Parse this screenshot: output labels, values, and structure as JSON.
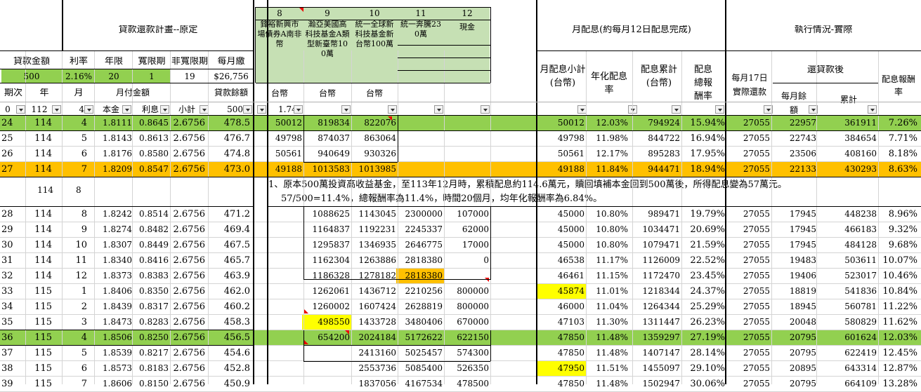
{
  "plan_title": "貸款還款計畫--原定",
  "dividend_title": "月配息(約每月12日配息完成)",
  "exec_title": "執行情況-實際",
  "loan_headers": [
    "貸款金額",
    "利率",
    "年限",
    "寬限期",
    "非寬限期",
    "每月繳"
  ],
  "loan_values": [
    "500",
    "2.16%",
    "20",
    "1",
    "19",
    "$26,756"
  ],
  "col_headers": [
    "期次",
    "年",
    "月",
    "月付金額",
    "貸款餘額"
  ],
  "filter_row": [
    "0",
    "112",
    "4",
    "本金",
    "利息",
    "小計",
    "500",
    "1.74"
  ],
  "funds": [
    {
      "no": "8",
      "name": "鋒裕新興市場債券A南非幣"
    },
    {
      "no": "9",
      "name": "瀚亞美國高科技基金A類型新臺幣100萬"
    },
    {
      "no": "10",
      "name": "統一全球新科技基金新台幣100萬"
    },
    {
      "no": "11",
      "name": "統一奔騰230萬"
    },
    {
      "no": "12",
      "name": "現金"
    }
  ],
  "currency_labels": [
    "台幣",
    "台幣",
    "台幣"
  ],
  "div_headers": [
    "月配息小計(台幣)",
    "年化配息率",
    "配息累計(台幣)",
    "配息總報酬率"
  ],
  "exec_headers": {
    "repay": "每月17日實際還款",
    "after": "還貸款後",
    "monthly": "每月餘額",
    "cumulative": "累計",
    "rate": "配息報酬率"
  },
  "note_line1": "1、原本500萬投資高收益基金，至113年12月時，累積配息約114.6萬元，贖回填補本金回到500萬後，所得配息變為57萬元。",
  "note_line2": "57/500=11.4%，總報酬率為11.4%，時間20個月，均年化報酬率為6.84%。",
  "rows": [
    {
      "p": "24",
      "y": "114",
      "m": "4",
      "pr": "1.8111",
      "it": "0.8645",
      "st": "2.6756",
      "bal": "478.5",
      "f8": "50012",
      "f9": "819834",
      "f10": "822076",
      "f11": "",
      "f12": "",
      "ds": "50012",
      "ar": "12.03%",
      "cum": "794924",
      "tr": "15.94%",
      "rp": "27055",
      "mb": "22957",
      "cb": "361911",
      "rr": "7.26%",
      "hl": "green"
    },
    {
      "p": "25",
      "y": "114",
      "m": "5",
      "pr": "1.8143",
      "it": "0.8613",
      "st": "2.6756",
      "bal": "476.7",
      "f8": "49798",
      "f9": "874037",
      "f10": "863064",
      "f11": "",
      "f12": "",
      "ds": "49798",
      "ar": "11.98%",
      "cum": "844722",
      "tr": "16.94%",
      "rp": "27055",
      "mb": "22743",
      "cb": "384654",
      "rr": "7.71%",
      "hl": ""
    },
    {
      "p": "26",
      "y": "114",
      "m": "6",
      "pr": "1.8176",
      "it": "0.8580",
      "st": "2.6756",
      "bal": "474.8",
      "f8": "50561",
      "f9": "940649",
      "f10": "930326",
      "f11": "",
      "f12": "",
      "ds": "50561",
      "ar": "12.17%",
      "cum": "895283",
      "tr": "17.95%",
      "rp": "27055",
      "mb": "23506",
      "cb": "408160",
      "rr": "8.18%",
      "hl": ""
    },
    {
      "p": "27",
      "y": "114",
      "m": "7",
      "pr": "1.8209",
      "it": "0.8547",
      "st": "2.6756",
      "bal": "473.0",
      "f8": "49188",
      "f9": "1013583",
      "f10": "1013985",
      "f11": "",
      "f12": "",
      "ds": "49188",
      "ar": "11.84%",
      "cum": "944471",
      "tr": "18.94%",
      "rp": "27055",
      "mb": "22133",
      "cb": "430293",
      "rr": "8.63%",
      "hl": "orange"
    },
    {
      "p": "",
      "y": "114",
      "m": "8",
      "pr": "",
      "it": "",
      "st": "",
      "bal": "",
      "f8": "",
      "f9": "",
      "f10": "",
      "f11": "",
      "f12": "",
      "ds": "",
      "ar": "",
      "cum": "",
      "tr": "",
      "rp": "",
      "mb": "",
      "cb": "",
      "rr": "",
      "hl": "note"
    },
    {
      "p": "28",
      "y": "114",
      "m": "8",
      "pr": "1.8242",
      "it": "0.8514",
      "st": "2.6756",
      "bal": "471.2",
      "f8": "",
      "f9": "1088625",
      "f10": "1143045",
      "f11": "2300000",
      "f12": "107000",
      "ds": "45000",
      "ar": "10.80%",
      "cum": "989471",
      "tr": "19.79%",
      "rp": "27055",
      "mb": "17945",
      "cb": "448238",
      "rr": "8.96%",
      "hl": ""
    },
    {
      "p": "29",
      "y": "114",
      "m": "9",
      "pr": "1.8274",
      "it": "0.8482",
      "st": "2.6756",
      "bal": "469.4",
      "f8": "",
      "f9": "1164837",
      "f10": "1192231",
      "f11": "2245337",
      "f12": "62000",
      "ds": "45000",
      "ar": "10.80%",
      "cum": "1034471",
      "tr": "20.69%",
      "rp": "27055",
      "mb": "17945",
      "cb": "466183",
      "rr": "9.32%",
      "hl": ""
    },
    {
      "p": "30",
      "y": "114",
      "m": "10",
      "pr": "1.8307",
      "it": "0.8449",
      "st": "2.6756",
      "bal": "467.5",
      "f8": "",
      "f9": "1295837",
      "f10": "1346935",
      "f11": "2646775",
      "f12": "17000",
      "ds": "45000",
      "ar": "10.80%",
      "cum": "1079471",
      "tr": "21.59%",
      "rp": "27055",
      "mb": "17945",
      "cb": "484128",
      "rr": "9.68%",
      "hl": ""
    },
    {
      "p": "31",
      "y": "114",
      "m": "11",
      "pr": "1.8340",
      "it": "0.8416",
      "st": "2.6756",
      "bal": "465.7",
      "f8": "",
      "f9": "1162304",
      "f10": "1263886",
      "f11": "2818380",
      "f12": "0",
      "ds": "46538",
      "ar": "11.17%",
      "cum": "1126009",
      "tr": "22.52%",
      "rp": "27055",
      "mb": "19483",
      "cb": "503611",
      "rr": "10.07%",
      "hl": ""
    },
    {
      "p": "32",
      "y": "114",
      "m": "12",
      "pr": "1.8373",
      "it": "0.8383",
      "st": "2.6756",
      "bal": "463.9",
      "f8": "",
      "f9": "1186328",
      "f10": "1278182",
      "f11": "2818380",
      "f12": "",
      "ds": "46461",
      "ar": "11.15%",
      "cum": "1172470",
      "tr": "23.45%",
      "rp": "27055",
      "mb": "19406",
      "cb": "523017",
      "rr": "10.46%",
      "hl": ""
    },
    {
      "p": "33",
      "y": "115",
      "m": "1",
      "pr": "1.8406",
      "it": "0.8350",
      "st": "2.6756",
      "bal": "462.0",
      "f8": "",
      "f9": "1262061",
      "f10": "1436712",
      "f11": "2210256",
      "f12": "800000",
      "ds": "45874",
      "ar": "11.01%",
      "cum": "1218344",
      "tr": "24.37%",
      "rp": "27055",
      "mb": "18819",
      "cb": "541836",
      "rr": "10.84%",
      "hl": ""
    },
    {
      "p": "34",
      "y": "115",
      "m": "2",
      "pr": "1.8439",
      "it": "0.8317",
      "st": "2.6756",
      "bal": "460.2",
      "f8": "",
      "f9": "1260002",
      "f10": "1607424",
      "f11": "2628819",
      "f12": "800000",
      "ds": "46000",
      "ar": "11.04%",
      "cum": "1264344",
      "tr": "25.29%",
      "rp": "27055",
      "mb": "18945",
      "cb": "560781",
      "rr": "11.22%",
      "hl": ""
    },
    {
      "p": "35",
      "y": "115",
      "m": "3",
      "pr": "1.8473",
      "it": "0.8283",
      "st": "2.6756",
      "bal": "458.3",
      "f8": "",
      "f9": "498550",
      "f10": "1433728",
      "f11": "3480406",
      "f12": "670000",
      "ds": "47103",
      "ar": "11.30%",
      "cum": "1311447",
      "tr": "26.23%",
      "rp": "27055",
      "mb": "20048",
      "cb": "580829",
      "rr": "11.62%",
      "hl": ""
    },
    {
      "p": "36",
      "y": "115",
      "m": "4",
      "pr": "1.8506",
      "it": "0.8250",
      "st": "2.6756",
      "bal": "456.5",
      "f8": "",
      "f9": "654200",
      "f10": "2024184",
      "f11": "5172622",
      "f12": "622150",
      "ds": "47850",
      "ar": "11.48%",
      "cum": "1359297",
      "tr": "27.19%",
      "rp": "27055",
      "mb": "20795",
      "cb": "601624",
      "rr": "12.03%",
      "hl": "green"
    },
    {
      "p": "37",
      "y": "115",
      "m": "5",
      "pr": "1.8539",
      "it": "0.8217",
      "st": "2.6756",
      "bal": "454.6",
      "f8": "",
      "f9": "",
      "f10": "2413160",
      "f11": "5025457",
      "f12": "574300",
      "ds": "47850",
      "ar": "11.48%",
      "cum": "1407147",
      "tr": "28.14%",
      "rp": "27055",
      "mb": "20795",
      "cb": "622419",
      "rr": "12.45%",
      "hl": ""
    },
    {
      "p": "38",
      "y": "115",
      "m": "6",
      "pr": "1.8573",
      "it": "0.8183",
      "st": "2.6756",
      "bal": "452.8",
      "f8": "",
      "f9": "",
      "f10": "2553736",
      "f11": "5085400",
      "f12": "526350",
      "ds": "47950",
      "ar": "11.51%",
      "cum": "1455097",
      "tr": "29.10%",
      "rp": "27055",
      "mb": "20895",
      "cb": "643314",
      "rr": "12.87%",
      "hl": ""
    },
    {
      "p": "39",
      "y": "115",
      "m": "7",
      "pr": "1.8606",
      "it": "0.8150",
      "st": "2.6756",
      "bal": "450.9",
      "f8": "",
      "f9": "",
      "f10": "1837056",
      "f11": "4167534",
      "f12": "478500",
      "ds": "47850",
      "ar": "11.48%",
      "cum": "1502947",
      "tr": "30.06%",
      "rp": "27055",
      "mb": "20795",
      "cb": "664109",
      "rr": "13.28%",
      "hl": ""
    }
  ],
  "colors": {
    "green": "#92d050",
    "orange": "#ffc000",
    "yellow": "#ffff00",
    "light_green": "#c6e0b4",
    "note_red": "#e00000"
  }
}
